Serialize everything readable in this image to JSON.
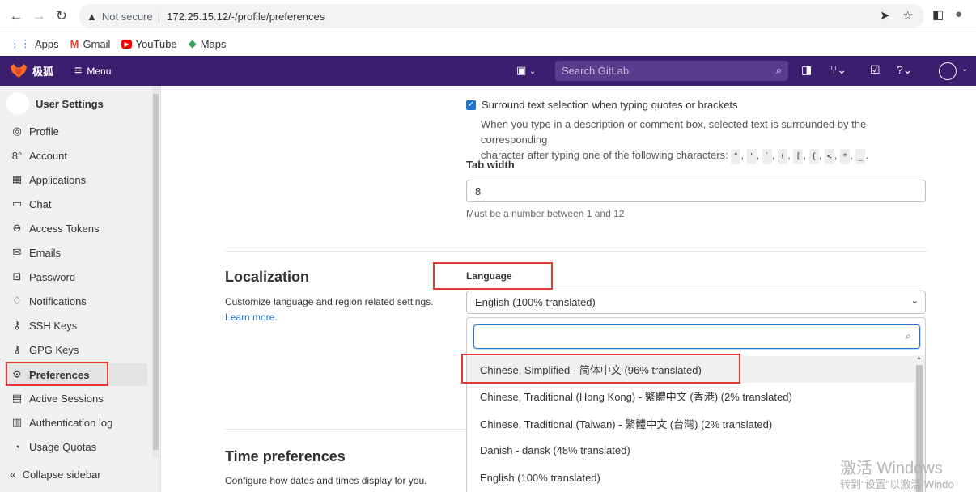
{
  "browser": {
    "url_warning": "Not secure",
    "url": "172.25.15.12/-/profile/preferences"
  },
  "bookmarks": [
    {
      "label": "Apps"
    },
    {
      "label": "Gmail"
    },
    {
      "label": "YouTube"
    },
    {
      "label": "Maps"
    }
  ],
  "header": {
    "brand": "极狐",
    "menu_label": "Menu",
    "search_placeholder": "Search GitLab"
  },
  "sidebar": {
    "title": "User Settings",
    "items": [
      {
        "label": "Profile",
        "icon": "profile-icon"
      },
      {
        "label": "Account",
        "icon": "account-icon"
      },
      {
        "label": "Applications",
        "icon": "applications-icon"
      },
      {
        "label": "Chat",
        "icon": "chat-icon"
      },
      {
        "label": "Access Tokens",
        "icon": "token-icon"
      },
      {
        "label": "Emails",
        "icon": "mail-icon"
      },
      {
        "label": "Password",
        "icon": "lock-icon"
      },
      {
        "label": "Notifications",
        "icon": "bell-icon"
      },
      {
        "label": "SSH Keys",
        "icon": "key-icon"
      },
      {
        "label": "GPG Keys",
        "icon": "key-icon"
      },
      {
        "label": "Preferences",
        "icon": "preferences-icon"
      },
      {
        "label": "Active Sessions",
        "icon": "monitor-icon"
      },
      {
        "label": "Authentication log",
        "icon": "log-icon"
      },
      {
        "label": "Usage Quotas",
        "icon": "quota-icon"
      }
    ],
    "collapse_label": "Collapse sidebar"
  },
  "behavior": {
    "surround_label": "Surround text selection when typing quotes or brackets",
    "surround_help_1": "When you type in a description or comment box, selected text is surrounded by the corresponding",
    "surround_help_2": "character after typing one of the following characters:",
    "chars": [
      "\"",
      "'",
      "`",
      "(",
      "[",
      "{",
      "<",
      "*",
      "_"
    ],
    "tab_width_label": "Tab width",
    "tab_width_value": "8",
    "tab_width_help": "Must be a number between 1 and 12"
  },
  "localization": {
    "title": "Localization",
    "description": "Customize language and region related settings.",
    "learn_more": "Learn more.",
    "language_label": "Language",
    "language_value": "English (100% translated)",
    "options": [
      "Chinese, Simplified - 简体中文 (96% translated)",
      "Chinese, Traditional (Hong Kong) - 繁體中文 (香港) (2% translated)",
      "Chinese, Traditional (Taiwan) - 繁體中文 (台灣) (2% translated)",
      "Danish - dansk (48% translated)",
      "English (100% translated)"
    ]
  },
  "time": {
    "title": "Time preferences",
    "description": "Configure how dates and times display for you."
  },
  "watermark": {
    "line1": "激活 Windows",
    "line2": "转到\"设置\"以激活 Windo"
  }
}
